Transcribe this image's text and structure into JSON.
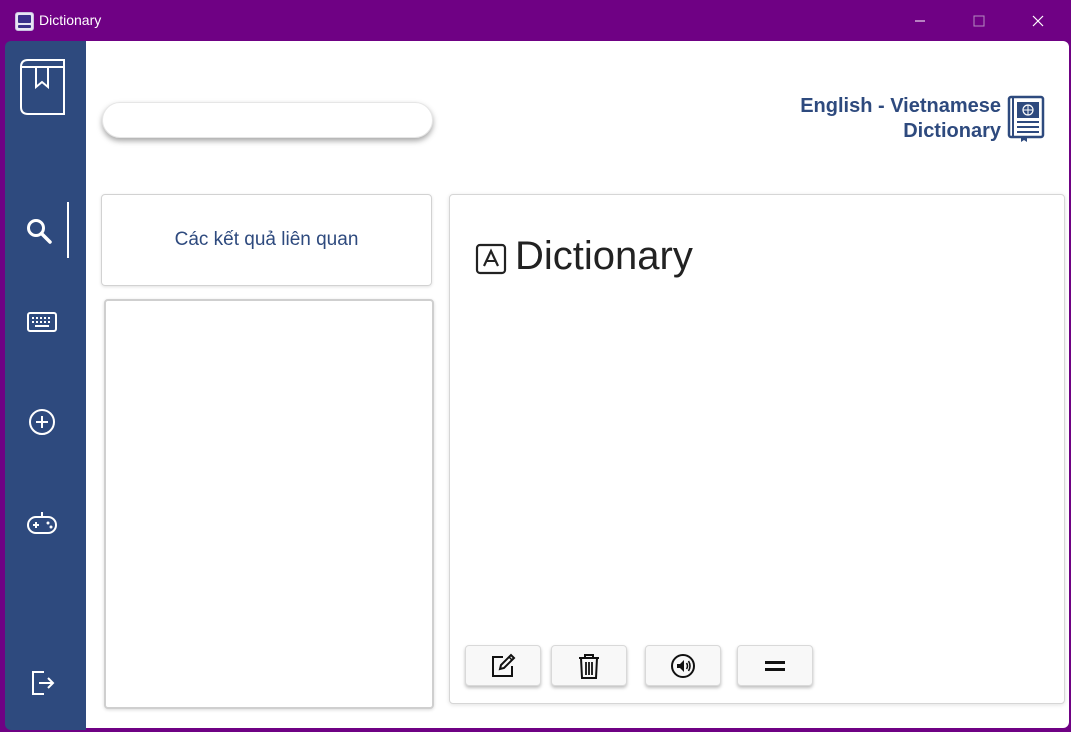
{
  "window": {
    "title": "Dictionary",
    "titlebar_color": "#6f0184"
  },
  "sidebar": {
    "color": "#2e4a7e",
    "items": [
      {
        "name": "logo",
        "icon": "bookmark-book-icon"
      },
      {
        "name": "search",
        "icon": "search-icon",
        "active": true
      },
      {
        "name": "keyboard",
        "icon": "keyboard-icon"
      },
      {
        "name": "add",
        "icon": "plus-circle-icon"
      },
      {
        "name": "game",
        "icon": "gamepad-icon"
      },
      {
        "name": "logout",
        "icon": "logout-icon"
      }
    ]
  },
  "search": {
    "value": "",
    "placeholder": ""
  },
  "brand": {
    "line1": "English - Vietnamese",
    "line2": "Dictionary",
    "icon": "dictionary-book-icon"
  },
  "related": {
    "label": "Các kết quả liên quan"
  },
  "definition": {
    "word": "Dictionary",
    "icon": "letter-a-box-icon"
  },
  "actions": [
    {
      "name": "edit",
      "icon": "edit-icon"
    },
    {
      "name": "delete",
      "icon": "trash-icon"
    },
    {
      "name": "speak",
      "icon": "speaker-icon"
    },
    {
      "name": "menu",
      "icon": "equals-icon"
    }
  ]
}
